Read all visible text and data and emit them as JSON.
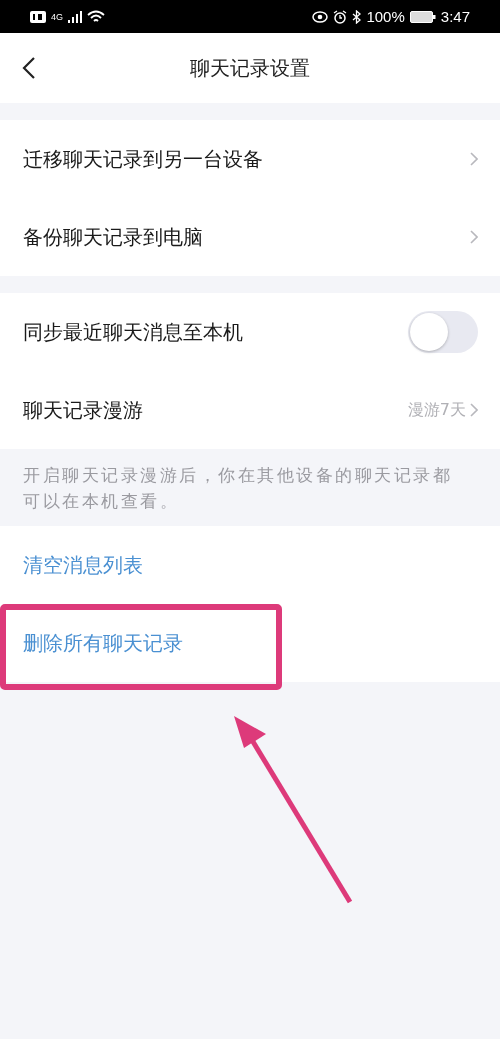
{
  "status_bar": {
    "network": "4G",
    "battery": "100%",
    "time": "3:47"
  },
  "header": {
    "title": "聊天记录设置"
  },
  "sections": [
    {
      "rows": [
        {
          "kind": "link",
          "label": "迁移聊天记录到另一台设备"
        },
        {
          "kind": "link",
          "label": "备份聊天记录到电脑"
        }
      ]
    },
    {
      "rows": [
        {
          "kind": "toggle",
          "label": "同步最近聊天消息至本机",
          "on": false
        },
        {
          "kind": "link",
          "label": "聊天记录漫游",
          "value": "漫游7天"
        }
      ],
      "note": "开启聊天记录漫游后，你在其他设备的聊天记录都可以在本机查看。"
    },
    {
      "rows": [
        {
          "kind": "action",
          "label": "清空消息列表"
        },
        {
          "kind": "action",
          "label": "删除所有聊天记录",
          "highlighted": true
        }
      ]
    }
  ]
}
